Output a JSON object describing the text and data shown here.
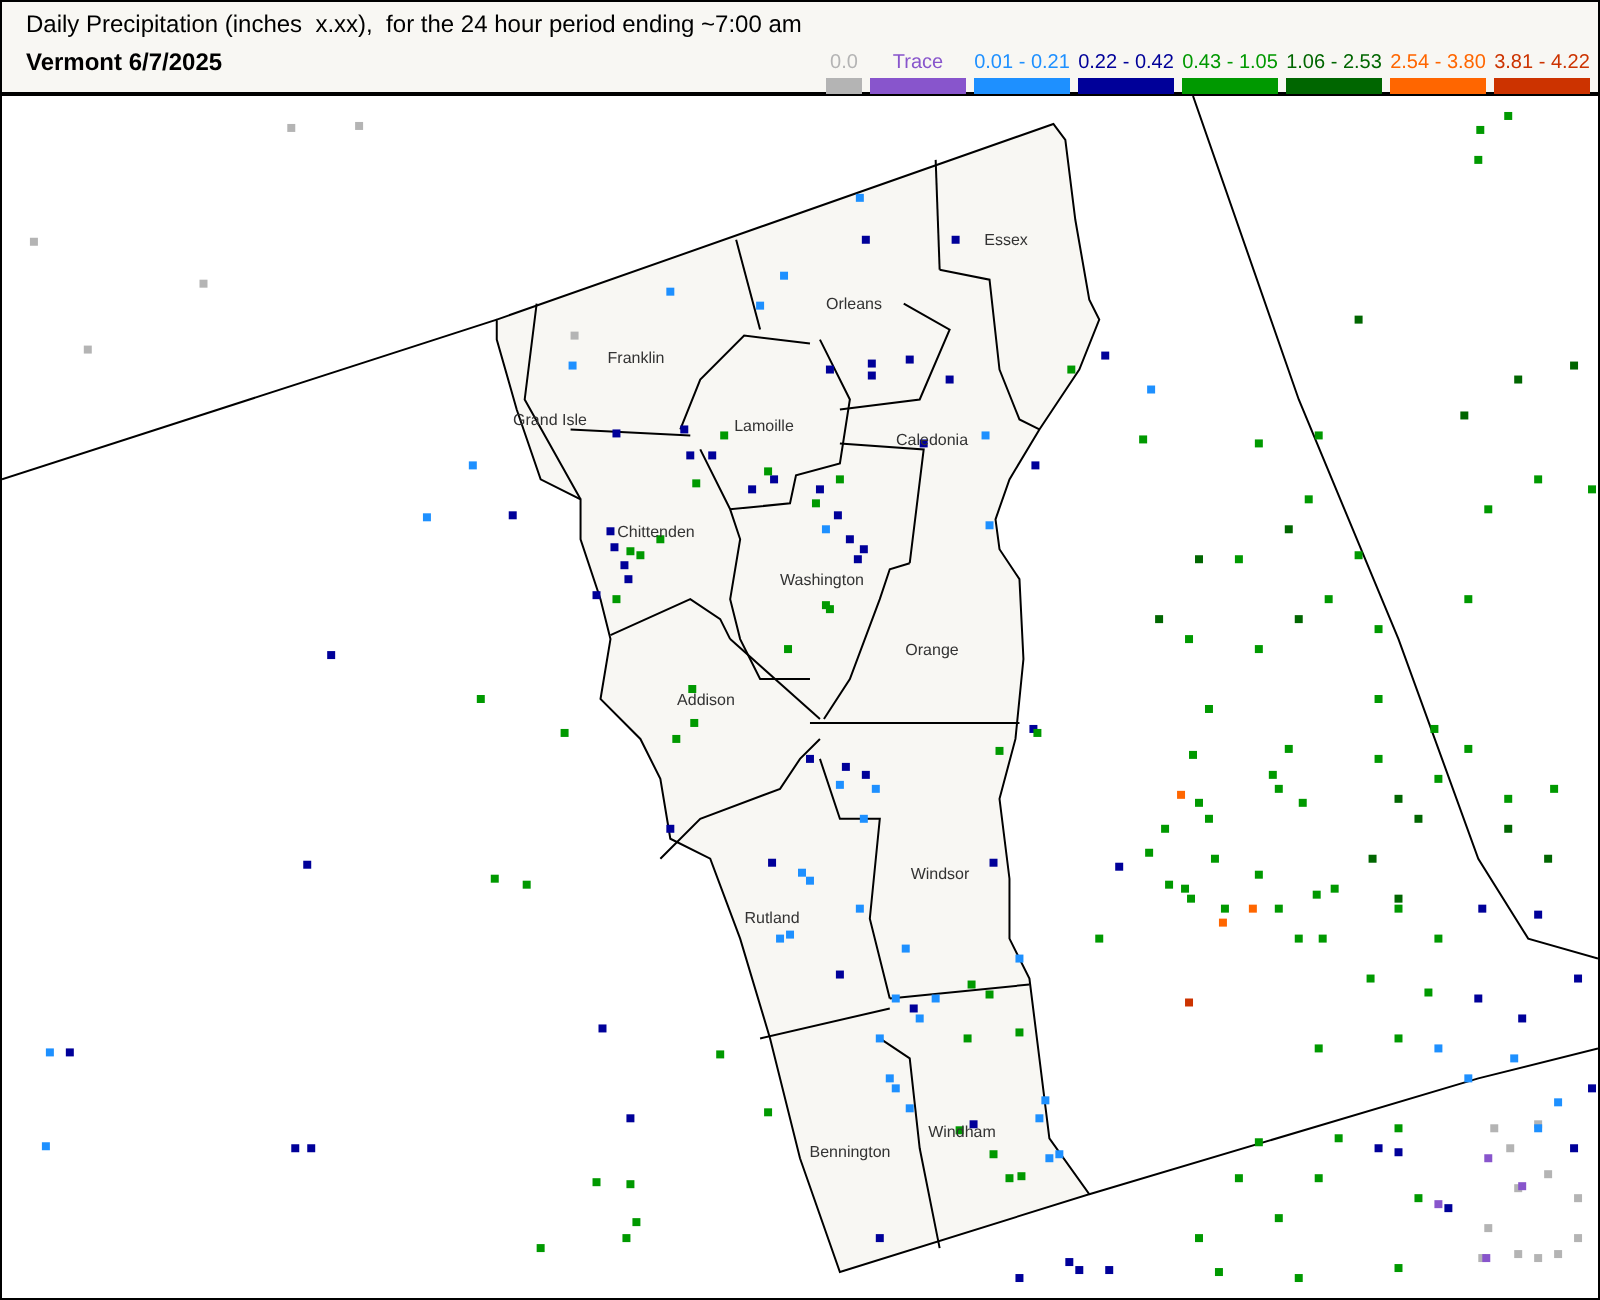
{
  "header": {
    "title": "Daily Precipitation (inches  x.xx),  for the 24 hour period ending ~7:00 am",
    "subtitle": "Vermont 6/7/2025"
  },
  "legend": [
    {
      "label": "0.0",
      "color": "#b4b4b4"
    },
    {
      "label": "Trace",
      "color": "#8855cc"
    },
    {
      "label": "0.01 - 0.21",
      "color": "#1e90ff"
    },
    {
      "label": "0.22 - 0.42",
      "color": "#000099"
    },
    {
      "label": "0.43 - 1.05",
      "color": "#009900"
    },
    {
      "label": "1.06 - 2.53",
      "color": "#006600"
    },
    {
      "label": "2.54 - 3.80",
      "color": "#ff6600"
    },
    {
      "label": "3.81 - 4.22",
      "color": "#cc3300"
    }
  ],
  "map": {
    "counties": [
      "Essex",
      "Orleans",
      "Franklin",
      "Grand Isle",
      "Lamoille",
      "Caledonia",
      "Chittenden",
      "Washington",
      "Orange",
      "Addison",
      "Windsor",
      "Rutland",
      "Bennington",
      "Windham"
    ]
  }
}
